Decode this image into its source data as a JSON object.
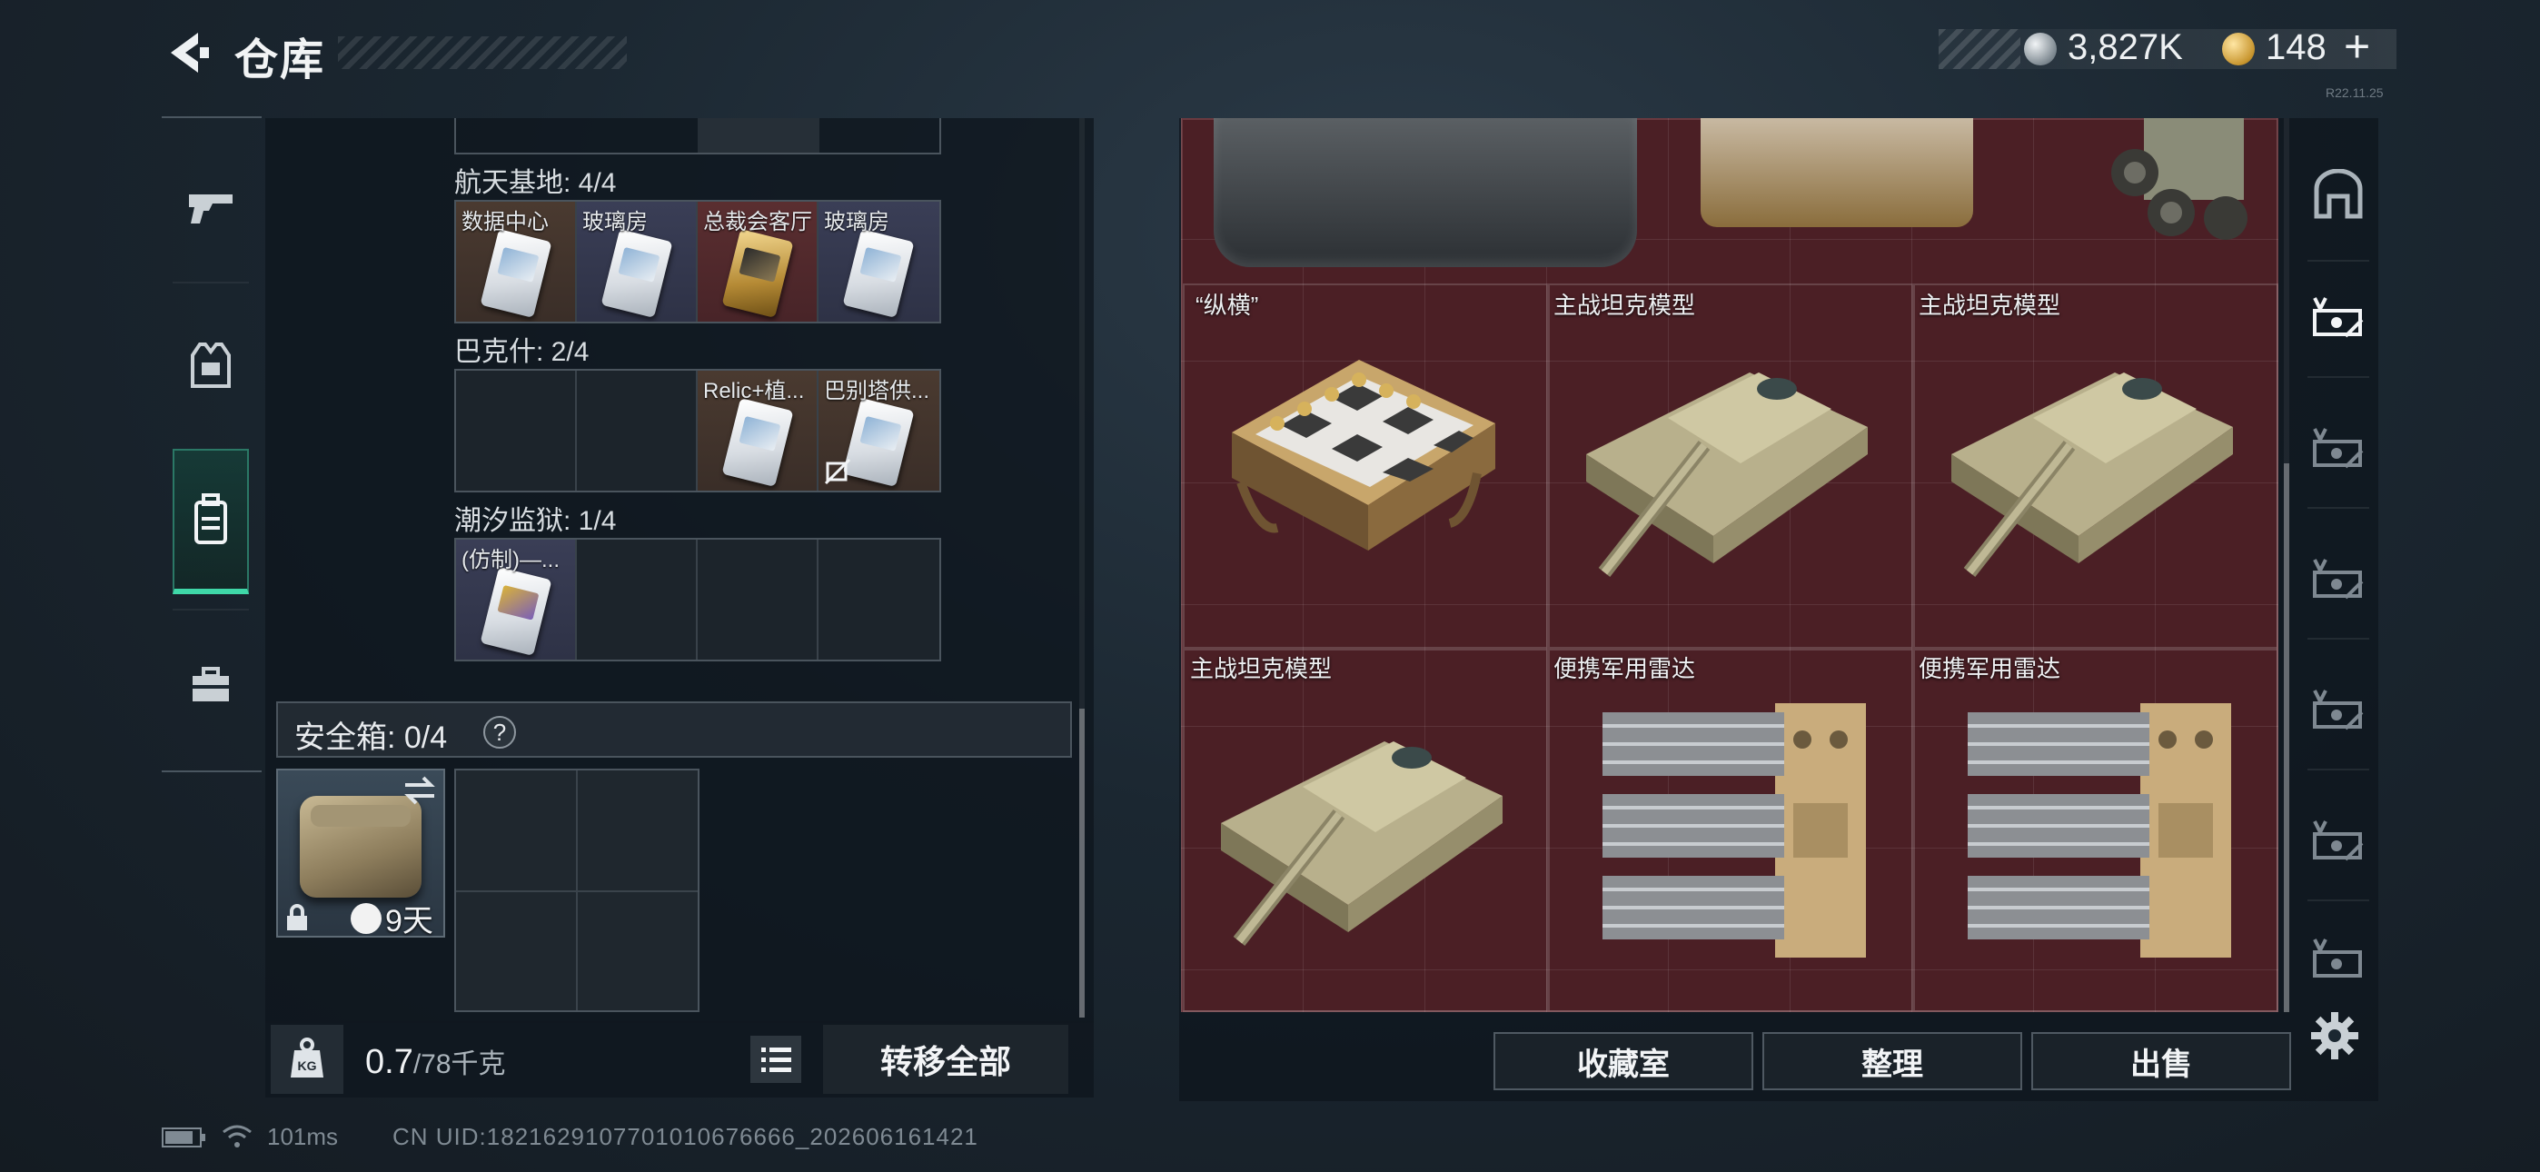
{
  "header": {
    "title": "仓库",
    "currency_silver": "3,827K",
    "currency_gold": "148",
    "plus": "+",
    "mini_text": "R22.11.25"
  },
  "left_nav": {
    "items": [
      {
        "name": "weapon",
        "icon": "pistol-icon"
      },
      {
        "name": "armor",
        "icon": "vest-icon"
      },
      {
        "name": "backpack",
        "icon": "backpack-icon",
        "active": true
      },
      {
        "name": "case",
        "icon": "toolbox-icon"
      }
    ]
  },
  "keycards": {
    "section1": {
      "label": "航天基地: 4/4",
      "slots": [
        "数据中心",
        "玻璃房",
        "总裁会客厅",
        "玻璃房"
      ]
    },
    "section2": {
      "label": "巴克什: 2/4",
      "slots": [
        "",
        "",
        "Relic+植...",
        "巴别塔供..."
      ]
    },
    "section3": {
      "label": "潮汐监狱: 1/4",
      "slots": [
        "(仿制)—...",
        "",
        "",
        ""
      ]
    }
  },
  "safe_box": {
    "title": "安全箱: 0/4",
    "help": "?",
    "days": "9天"
  },
  "weight": {
    "current": "0.7",
    "capacity": "/78千克"
  },
  "left_actions": {
    "transfer_all": "转移全部"
  },
  "stash": {
    "items": [
      {
        "label": "“纵横”"
      },
      {
        "label": "主战坦克模型"
      },
      {
        "label": "主战坦克模型"
      },
      {
        "label": "主战坦克模型"
      },
      {
        "label": "便携军用雷达"
      },
      {
        "label": "便携军用雷达"
      }
    ]
  },
  "bottom_buttons": {
    "collection": "收藏室",
    "sort": "整理",
    "sell": "出售"
  },
  "right_column": {
    "icons": [
      "safehouse-icon",
      "stash-tab-icon-1",
      "stash-tab-icon-2",
      "stash-tab-icon-3",
      "stash-tab-icon-4",
      "stash-tab-icon-5",
      "stash-tab-icon-6",
      "stash-tab-icon-7",
      "settings-gear-icon"
    ]
  },
  "footer": {
    "ping": "101ms",
    "uid": "CN UID:1821629107701010676666_202606161421"
  },
  "colors": {
    "accent_green": "#3fd8a8",
    "stash_bg": "#4b1f25",
    "panel_bg": "#0e161d"
  }
}
